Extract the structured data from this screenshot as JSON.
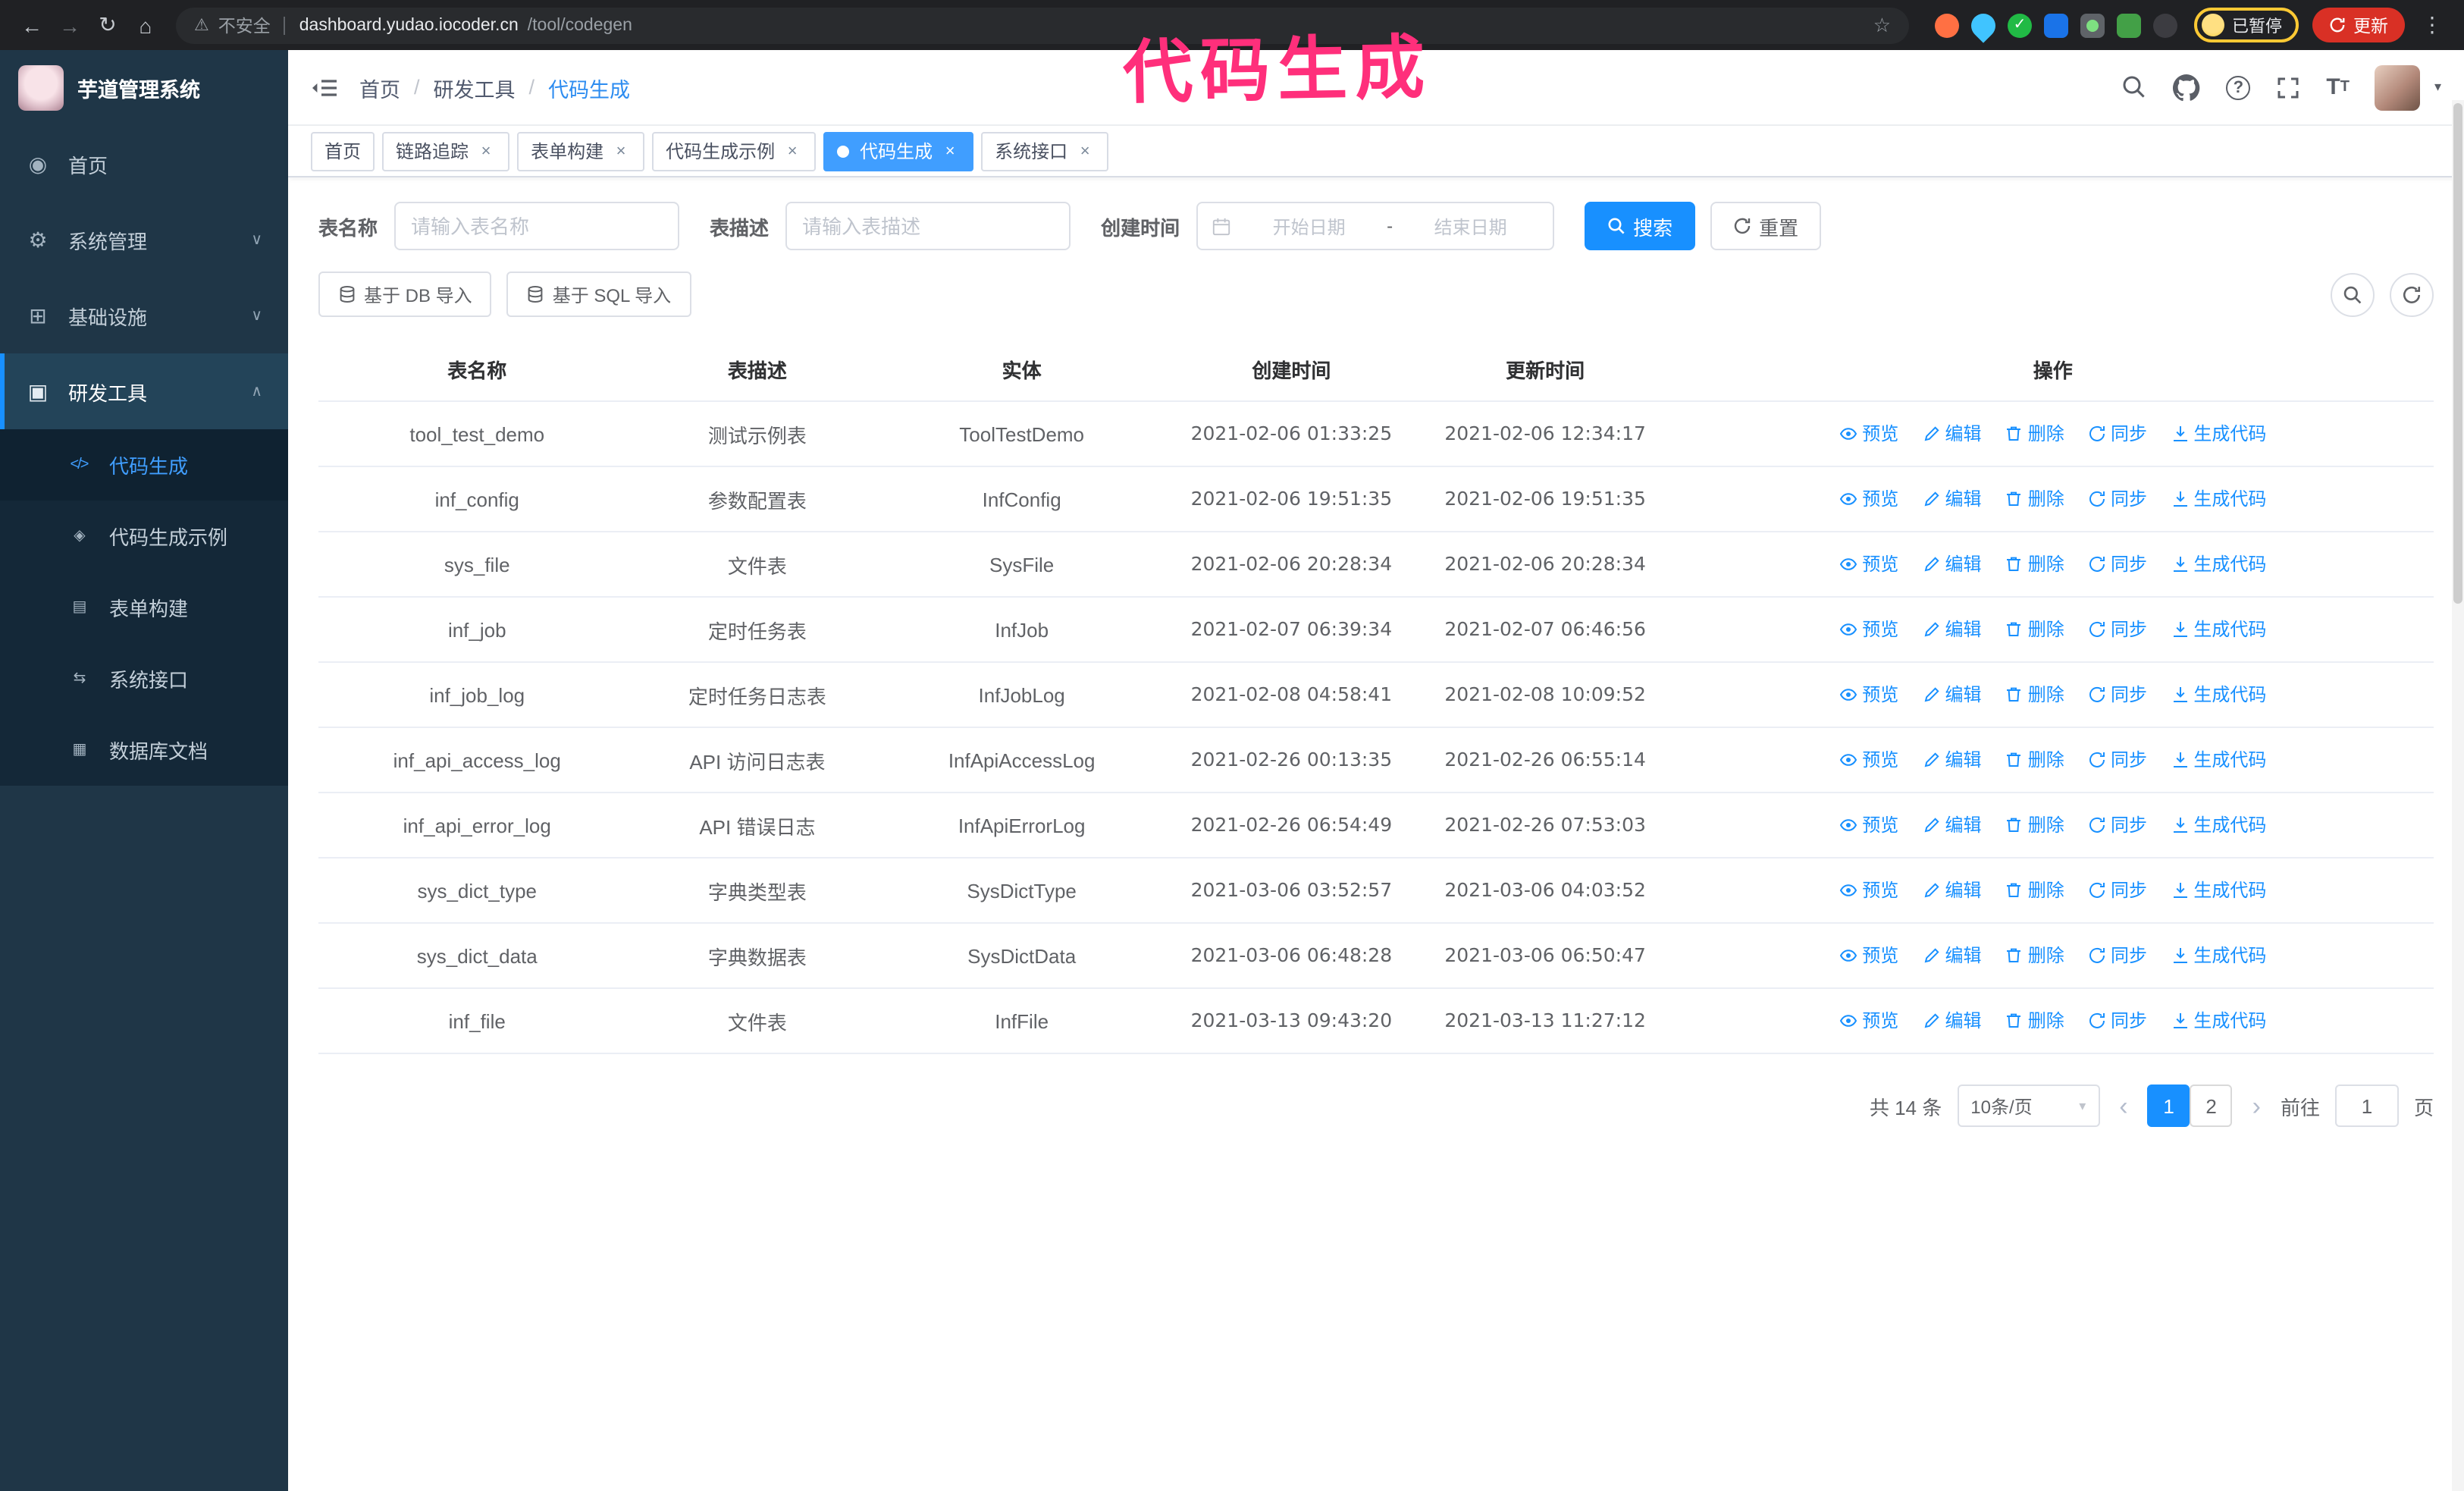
{
  "annotation": "代码生成",
  "icons": {
    "back": "←",
    "forward": "→",
    "reload": "↻",
    "home": "⌂",
    "warning": "⚠",
    "star": "☆",
    "kebab": "⋮",
    "close": "×",
    "caret_down": "▾",
    "question": "?",
    "font_size": "T",
    "check": "✓",
    "prev": "‹",
    "next": "›"
  },
  "browser": {
    "security_label": "不安全",
    "url_host": "dashboard.yudao.iocoder.cn",
    "url_path": "/tool/codegen",
    "paused_badge": "已暂停",
    "update_button": "更新"
  },
  "sidebar": {
    "logo_title": "芋道管理系统",
    "menu": [
      {
        "label": "首页",
        "glyph": "◉"
      },
      {
        "label": "系统管理",
        "glyph": "⚙",
        "chevron": "∨"
      },
      {
        "label": "基础设施",
        "glyph": "⊞",
        "chevron": "∨"
      },
      {
        "label": "研发工具",
        "glyph": "▣",
        "chevron": "∧",
        "open": true
      }
    ],
    "submenu": [
      {
        "label": "代码生成",
        "glyph": "</>",
        "active": true
      },
      {
        "label": "代码生成示例",
        "glyph": "◈"
      },
      {
        "label": "表单构建",
        "glyph": "▤"
      },
      {
        "label": "系统接口",
        "glyph": "⇆"
      },
      {
        "label": "数据库文档",
        "glyph": "▦"
      }
    ]
  },
  "breadcrumb": [
    "首页",
    "研发工具",
    "代码生成"
  ],
  "tabs": [
    {
      "label": "首页",
      "affix": true
    },
    {
      "label": "链路追踪"
    },
    {
      "label": "表单构建"
    },
    {
      "label": "代码生成示例"
    },
    {
      "label": "代码生成",
      "active": true
    },
    {
      "label": "系统接口"
    }
  ],
  "filters": {
    "table_name_label": "表名称",
    "table_name_placeholder": "请输入表名称",
    "table_desc_label": "表描述",
    "table_desc_placeholder": "请输入表描述",
    "create_time_label": "创建时间",
    "date_start_placeholder": "开始日期",
    "date_separator": "-",
    "date_end_placeholder": "结束日期",
    "search_button": "搜索",
    "reset_button": "重置"
  },
  "toolbar": {
    "import_db_button": "基于 DB 导入",
    "import_sql_button": "基于 SQL 导入"
  },
  "table": {
    "columns": [
      "表名称",
      "表描述",
      "实体",
      "创建时间",
      "更新时间",
      "操作"
    ],
    "actions": [
      "预览",
      "编辑",
      "删除",
      "同步",
      "生成代码"
    ],
    "rows": [
      {
        "name": "tool_test_demo",
        "desc": "测试示例表",
        "entity": "ToolTestDemo",
        "created": "2021-02-06 01:33:25",
        "updated": "2021-02-06 12:34:17"
      },
      {
        "name": "inf_config",
        "desc": "参数配置表",
        "entity": "InfConfig",
        "created": "2021-02-06 19:51:35",
        "updated": "2021-02-06 19:51:35"
      },
      {
        "name": "sys_file",
        "desc": "文件表",
        "entity": "SysFile",
        "created": "2021-02-06 20:28:34",
        "updated": "2021-02-06 20:28:34"
      },
      {
        "name": "inf_job",
        "desc": "定时任务表",
        "entity": "InfJob",
        "created": "2021-02-07 06:39:34",
        "updated": "2021-02-07 06:46:56"
      },
      {
        "name": "inf_job_log",
        "desc": "定时任务日志表",
        "entity": "InfJobLog",
        "created": "2021-02-08 04:58:41",
        "updated": "2021-02-08 10:09:52"
      },
      {
        "name": "inf_api_access_log",
        "desc": "API 访问日志表",
        "entity": "InfApiAccessLog",
        "created": "2021-02-26 00:13:35",
        "updated": "2021-02-26 06:55:14"
      },
      {
        "name": "inf_api_error_log",
        "desc": "API 错误日志",
        "entity": "InfApiErrorLog",
        "created": "2021-02-26 06:54:49",
        "updated": "2021-02-26 07:53:03"
      },
      {
        "name": "sys_dict_type",
        "desc": "字典类型表",
        "entity": "SysDictType",
        "created": "2021-03-06 03:52:57",
        "updated": "2021-03-06 04:03:52"
      },
      {
        "name": "sys_dict_data",
        "desc": "字典数据表",
        "entity": "SysDictData",
        "created": "2021-03-06 06:48:28",
        "updated": "2021-03-06 06:50:47"
      },
      {
        "name": "inf_file",
        "desc": "文件表",
        "entity": "InfFile",
        "created": "2021-03-13 09:43:20",
        "updated": "2021-03-13 11:27:12"
      }
    ]
  },
  "pagination": {
    "total": "共 14 条",
    "page_size": "10条/页",
    "pages": [
      {
        "num": "1",
        "active": true
      },
      {
        "num": "2"
      }
    ],
    "goto_label": "前往",
    "goto_value": "1",
    "goto_suffix": "页"
  }
}
